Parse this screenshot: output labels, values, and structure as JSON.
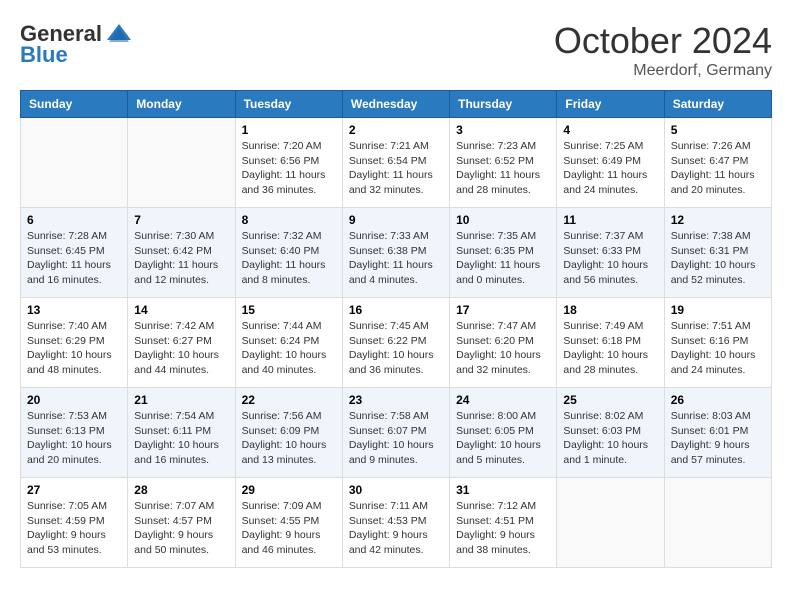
{
  "header": {
    "logo": {
      "line1": "General",
      "line2": "Blue"
    },
    "month": "October 2024",
    "location": "Meerdorf, Germany"
  },
  "weekdays": [
    "Sunday",
    "Monday",
    "Tuesday",
    "Wednesday",
    "Thursday",
    "Friday",
    "Saturday"
  ],
  "weeks": [
    [
      {
        "day": "",
        "sunrise": "",
        "sunset": "",
        "daylight": ""
      },
      {
        "day": "",
        "sunrise": "",
        "sunset": "",
        "daylight": ""
      },
      {
        "day": "1",
        "sunrise": "Sunrise: 7:20 AM",
        "sunset": "Sunset: 6:56 PM",
        "daylight": "Daylight: 11 hours and 36 minutes."
      },
      {
        "day": "2",
        "sunrise": "Sunrise: 7:21 AM",
        "sunset": "Sunset: 6:54 PM",
        "daylight": "Daylight: 11 hours and 32 minutes."
      },
      {
        "day": "3",
        "sunrise": "Sunrise: 7:23 AM",
        "sunset": "Sunset: 6:52 PM",
        "daylight": "Daylight: 11 hours and 28 minutes."
      },
      {
        "day": "4",
        "sunrise": "Sunrise: 7:25 AM",
        "sunset": "Sunset: 6:49 PM",
        "daylight": "Daylight: 11 hours and 24 minutes."
      },
      {
        "day": "5",
        "sunrise": "Sunrise: 7:26 AM",
        "sunset": "Sunset: 6:47 PM",
        "daylight": "Daylight: 11 hours and 20 minutes."
      }
    ],
    [
      {
        "day": "6",
        "sunrise": "Sunrise: 7:28 AM",
        "sunset": "Sunset: 6:45 PM",
        "daylight": "Daylight: 11 hours and 16 minutes."
      },
      {
        "day": "7",
        "sunrise": "Sunrise: 7:30 AM",
        "sunset": "Sunset: 6:42 PM",
        "daylight": "Daylight: 11 hours and 12 minutes."
      },
      {
        "day": "8",
        "sunrise": "Sunrise: 7:32 AM",
        "sunset": "Sunset: 6:40 PM",
        "daylight": "Daylight: 11 hours and 8 minutes."
      },
      {
        "day": "9",
        "sunrise": "Sunrise: 7:33 AM",
        "sunset": "Sunset: 6:38 PM",
        "daylight": "Daylight: 11 hours and 4 minutes."
      },
      {
        "day": "10",
        "sunrise": "Sunrise: 7:35 AM",
        "sunset": "Sunset: 6:35 PM",
        "daylight": "Daylight: 11 hours and 0 minutes."
      },
      {
        "day": "11",
        "sunrise": "Sunrise: 7:37 AM",
        "sunset": "Sunset: 6:33 PM",
        "daylight": "Daylight: 10 hours and 56 minutes."
      },
      {
        "day": "12",
        "sunrise": "Sunrise: 7:38 AM",
        "sunset": "Sunset: 6:31 PM",
        "daylight": "Daylight: 10 hours and 52 minutes."
      }
    ],
    [
      {
        "day": "13",
        "sunrise": "Sunrise: 7:40 AM",
        "sunset": "Sunset: 6:29 PM",
        "daylight": "Daylight: 10 hours and 48 minutes."
      },
      {
        "day": "14",
        "sunrise": "Sunrise: 7:42 AM",
        "sunset": "Sunset: 6:27 PM",
        "daylight": "Daylight: 10 hours and 44 minutes."
      },
      {
        "day": "15",
        "sunrise": "Sunrise: 7:44 AM",
        "sunset": "Sunset: 6:24 PM",
        "daylight": "Daylight: 10 hours and 40 minutes."
      },
      {
        "day": "16",
        "sunrise": "Sunrise: 7:45 AM",
        "sunset": "Sunset: 6:22 PM",
        "daylight": "Daylight: 10 hours and 36 minutes."
      },
      {
        "day": "17",
        "sunrise": "Sunrise: 7:47 AM",
        "sunset": "Sunset: 6:20 PM",
        "daylight": "Daylight: 10 hours and 32 minutes."
      },
      {
        "day": "18",
        "sunrise": "Sunrise: 7:49 AM",
        "sunset": "Sunset: 6:18 PM",
        "daylight": "Daylight: 10 hours and 28 minutes."
      },
      {
        "day": "19",
        "sunrise": "Sunrise: 7:51 AM",
        "sunset": "Sunset: 6:16 PM",
        "daylight": "Daylight: 10 hours and 24 minutes."
      }
    ],
    [
      {
        "day": "20",
        "sunrise": "Sunrise: 7:53 AM",
        "sunset": "Sunset: 6:13 PM",
        "daylight": "Daylight: 10 hours and 20 minutes."
      },
      {
        "day": "21",
        "sunrise": "Sunrise: 7:54 AM",
        "sunset": "Sunset: 6:11 PM",
        "daylight": "Daylight: 10 hours and 16 minutes."
      },
      {
        "day": "22",
        "sunrise": "Sunrise: 7:56 AM",
        "sunset": "Sunset: 6:09 PM",
        "daylight": "Daylight: 10 hours and 13 minutes."
      },
      {
        "day": "23",
        "sunrise": "Sunrise: 7:58 AM",
        "sunset": "Sunset: 6:07 PM",
        "daylight": "Daylight: 10 hours and 9 minutes."
      },
      {
        "day": "24",
        "sunrise": "Sunrise: 8:00 AM",
        "sunset": "Sunset: 6:05 PM",
        "daylight": "Daylight: 10 hours and 5 minutes."
      },
      {
        "day": "25",
        "sunrise": "Sunrise: 8:02 AM",
        "sunset": "Sunset: 6:03 PM",
        "daylight": "Daylight: 10 hours and 1 minute."
      },
      {
        "day": "26",
        "sunrise": "Sunrise: 8:03 AM",
        "sunset": "Sunset: 6:01 PM",
        "daylight": "Daylight: 9 hours and 57 minutes."
      }
    ],
    [
      {
        "day": "27",
        "sunrise": "Sunrise: 7:05 AM",
        "sunset": "Sunset: 4:59 PM",
        "daylight": "Daylight: 9 hours and 53 minutes."
      },
      {
        "day": "28",
        "sunrise": "Sunrise: 7:07 AM",
        "sunset": "Sunset: 4:57 PM",
        "daylight": "Daylight: 9 hours and 50 minutes."
      },
      {
        "day": "29",
        "sunrise": "Sunrise: 7:09 AM",
        "sunset": "Sunset: 4:55 PM",
        "daylight": "Daylight: 9 hours and 46 minutes."
      },
      {
        "day": "30",
        "sunrise": "Sunrise: 7:11 AM",
        "sunset": "Sunset: 4:53 PM",
        "daylight": "Daylight: 9 hours and 42 minutes."
      },
      {
        "day": "31",
        "sunrise": "Sunrise: 7:12 AM",
        "sunset": "Sunset: 4:51 PM",
        "daylight": "Daylight: 9 hours and 38 minutes."
      },
      {
        "day": "",
        "sunrise": "",
        "sunset": "",
        "daylight": ""
      },
      {
        "day": "",
        "sunrise": "",
        "sunset": "",
        "daylight": ""
      }
    ]
  ]
}
